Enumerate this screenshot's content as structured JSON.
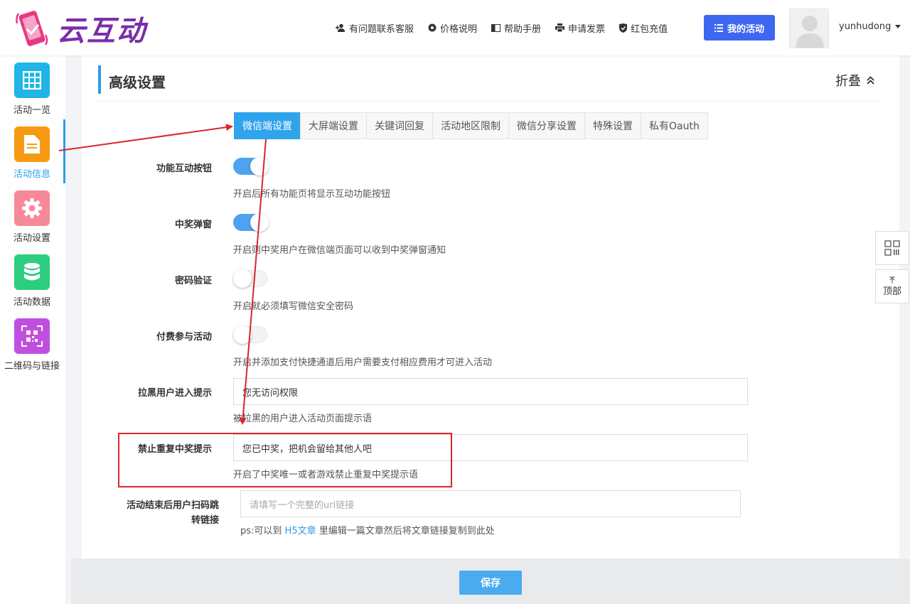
{
  "header": {
    "logo_text": "云互动",
    "nav": [
      {
        "label": "有问题联系客服",
        "icon": "add-user-icon"
      },
      {
        "label": "价格说明",
        "icon": "gear-icon"
      },
      {
        "label": "帮助手册",
        "icon": "book-icon"
      },
      {
        "label": "申请发票",
        "icon": "printer-icon"
      },
      {
        "label": "红包充值",
        "icon": "shield-check-icon"
      }
    ],
    "my_activity": "我的活动",
    "username": "yunhudong"
  },
  "sidebar": {
    "items": [
      {
        "label": "活动一览",
        "color": "#1fb5e6",
        "icon": "grid-icon",
        "active": false
      },
      {
        "label": "活动信息",
        "color": "#f79a13",
        "icon": "document-icon",
        "active": true
      },
      {
        "label": "活动设置",
        "color": "#f7899a",
        "icon": "gear-icon",
        "active": false
      },
      {
        "label": "活动数据",
        "color": "#2ecc80",
        "icon": "database-icon",
        "active": false
      },
      {
        "label": "二维码与链接",
        "color": "#c04fe0",
        "icon": "qrcode-icon",
        "active": false
      }
    ]
  },
  "panel": {
    "title": "高级设置",
    "fold_label": "折叠"
  },
  "tabs": [
    "微信端设置",
    "大屏端设置",
    "关键词回复",
    "活动地区限制",
    "微信分享设置",
    "特殊设置",
    "私有Oauth"
  ],
  "active_tab": 0,
  "rows": {
    "interact_button": {
      "label": "功能互动按钮",
      "on": true,
      "hint": "开启后所有功能页将显示互动功能按钮"
    },
    "win_popup": {
      "label": "中奖弹窗",
      "on": true,
      "hint": "开启则中奖用户在微信端页面可以收到中奖弹窗通知"
    },
    "password": {
      "label": "密码验证",
      "on": false,
      "hint": "开启就必须填写微信安全密码"
    },
    "paid": {
      "label": "付费参与活动",
      "on": false,
      "hint": "开启并添加支付快捷通道后用户需要支付相应费用才可进入活动"
    },
    "blacklist": {
      "label": "拉黑用户进入提示",
      "value": "您无访问权限",
      "hint": "被拉黑的用户进入活动页面提示语"
    },
    "repeat_win": {
      "label": "禁止重复中奖提示",
      "value": "您已中奖，把机会留给其他人吧",
      "hint": "开启了中奖唯一或者游戏禁止重复中奖提示语"
    },
    "redirect": {
      "label_line1": "活动结束后用户扫码跳",
      "label_line2": "转链接",
      "placeholder": "请填写一个完整的url链接",
      "hint_prefix": "ps:可以到",
      "hint_link": "H5文章",
      "hint_suffix": "里编辑一篇文章然后将文章链接复制到此处"
    }
  },
  "save_label": "保存",
  "float_top_label": "顶部",
  "colors": {
    "accent": "#2fa3ec",
    "primary_button": "#3d67f0",
    "annotation_red": "#d9262c"
  }
}
